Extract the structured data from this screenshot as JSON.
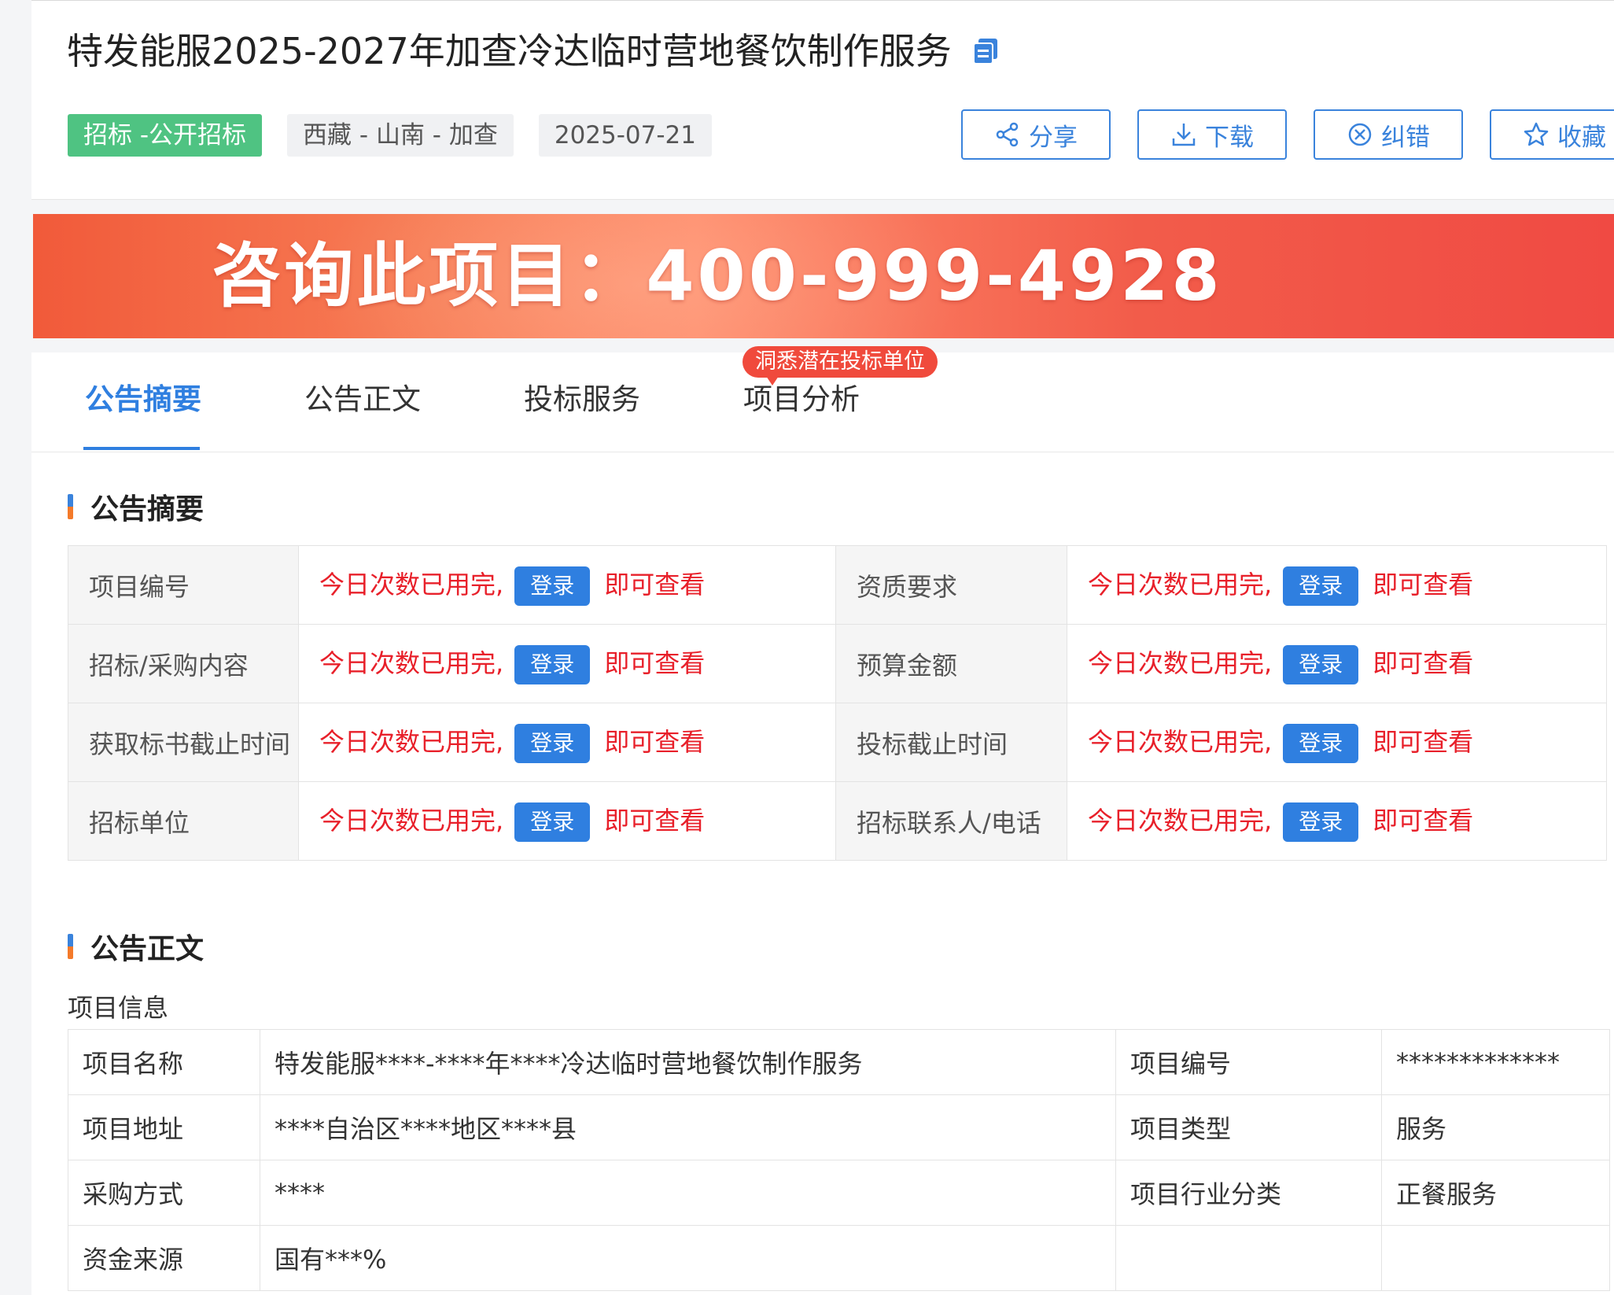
{
  "header": {
    "title": "特发能服2025-2027年加查冷达临时营地餐饮制作服务",
    "tags": [
      "招标 -公开招标",
      "西藏 - 山南 - 加查",
      "2025-07-21"
    ],
    "actions": [
      {
        "label": "分享",
        "icon": "share-icon"
      },
      {
        "label": "下载",
        "icon": "download-icon"
      },
      {
        "label": "纠错",
        "icon": "error-report-icon"
      },
      {
        "label": "收藏",
        "icon": "star-icon"
      }
    ]
  },
  "banner": {
    "text": "咨询此项目：400-999-4928"
  },
  "tabs": {
    "items": [
      "公告摘要",
      "公告正文",
      "投标服务",
      "项目分析"
    ],
    "active": "公告摘要",
    "badge": "洞悉潜在投标单位"
  },
  "summary": {
    "title": "公告摘要",
    "locked_text": "今日次数已用完,",
    "login_label": "登录",
    "view_text": "即可查看",
    "rows": [
      [
        "项目编号",
        "资质要求"
      ],
      [
        "招标/采购内容",
        "预算金额"
      ],
      [
        "获取标书截止时间",
        "投标截止时间"
      ],
      [
        "招标单位",
        "招标联系人/电话"
      ]
    ]
  },
  "content": {
    "title": "公告正文",
    "subtitle": "项目信息",
    "rows": [
      [
        "项目名称",
        "特发能服****-****年****冷达临时营地餐饮制作服务",
        "项目编号",
        "*************"
      ],
      [
        "项目地址",
        "****自治区****地区****县",
        "项目类型",
        "服务"
      ],
      [
        "采购方式",
        "****",
        "项目行业分类",
        "正餐服务"
      ],
      [
        "资金来源",
        "国有***%",
        "",
        ""
      ]
    ]
  },
  "colors": {
    "accent": "#2f7fe0",
    "tag_green": "#4fc382",
    "alert_red": "#e8202a",
    "banner": "#f15a3a"
  }
}
